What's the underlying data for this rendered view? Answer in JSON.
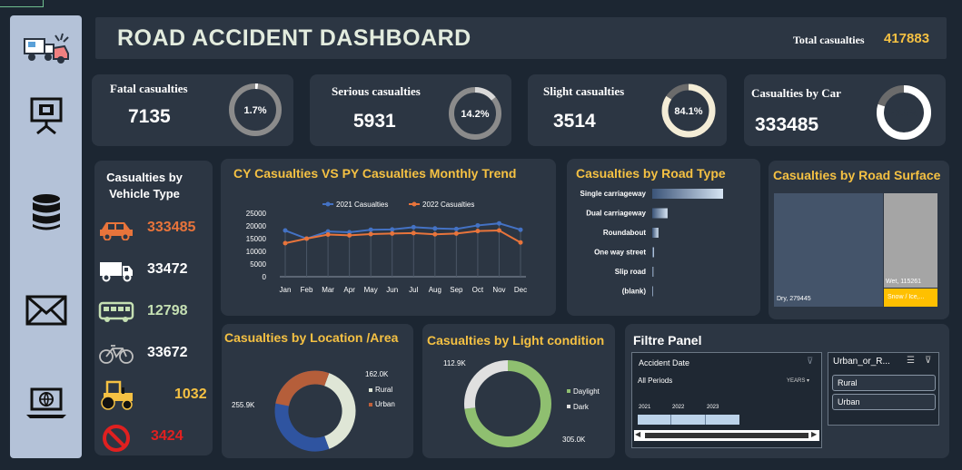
{
  "header": {
    "title": "ROAD ACCIDENT DASHBOARD",
    "total_label": "Total casualties",
    "total_value": "417883"
  },
  "sidebar": {
    "icons": [
      "accident-icon",
      "presentation-icon",
      "database-icon",
      "mail-icon",
      "laptop-globe-icon"
    ]
  },
  "kpis": [
    {
      "label": "Fatal casualties",
      "value": "7135",
      "pct_label": "1.7%",
      "pct": 1.7,
      "ring_color": "#8b8b8b"
    },
    {
      "label": "Serious casualties",
      "value": "5931",
      "pct_label": "14.2%",
      "pct": 14.2,
      "ring_color": "#8b8b8b"
    },
    {
      "label": "Slight casualties",
      "value": "3514",
      "pct_label": "84.1%",
      "pct": 84.1,
      "ring_color": "#f3ecd6"
    },
    {
      "label": "Casualties by Car",
      "value": "333485",
      "pct_label": "79.8%",
      "pct": 79.8,
      "ring_color": "#ffffff"
    }
  ],
  "vehicle_panel": {
    "title_line1": "Casualties by",
    "title_line2": "Vehicle Type",
    "items": [
      {
        "icon": "car-icon",
        "value": "333485",
        "color": "#e8743b"
      },
      {
        "icon": "truck-icon",
        "value": "33472",
        "color": "#ffffff"
      },
      {
        "icon": "bus-icon",
        "value": "12798",
        "color": "#c5e0b3"
      },
      {
        "icon": "bicycle-icon",
        "value": "33672",
        "color": "#ffffff"
      },
      {
        "icon": "tractor-icon",
        "value": "1032",
        "color": "#f5c143"
      },
      {
        "icon": "no-entry-icon",
        "value": "3424",
        "color": "#e02020"
      }
    ]
  },
  "trend": {
    "title": "CY Casualties VS PY Casualties Monthly Trend",
    "legend": [
      "2021 Casualties",
      "2022 Casualties"
    ]
  },
  "road_type": {
    "title": "Casualties  by Road Type"
  },
  "surface": {
    "title": "Casualties  by Road Surface",
    "labels": [
      "Dry, 279445",
      "Wet, 115261",
      "Snow / Ice,..."
    ]
  },
  "location": {
    "title": "Casualties  by Location /Area",
    "labels": [
      "162.0K",
      "255.9K"
    ],
    "legend": [
      "Rural",
      "Urban"
    ]
  },
  "light": {
    "title": "Casualties  by Light condition",
    "labels": [
      "112.9K",
      "305.0K"
    ],
    "legend": [
      "Daylight",
      "Dark"
    ]
  },
  "filter": {
    "title": "Filtre Panel",
    "timeline_title": "Accident  Date",
    "periods": "All Periods",
    "unit": "YEARS",
    "years": [
      "2021",
      "2022",
      "2023"
    ],
    "slicer_title": "Urban_or_R...",
    "slicer_items": [
      "Rural",
      "Urban"
    ]
  },
  "chart_data": [
    {
      "type": "line",
      "title": "CY Casualties VS PY Casualties Monthly Trend",
      "categories": [
        "Jan",
        "Feb",
        "Mar",
        "Apr",
        "May",
        "Jun",
        "Jul",
        "Aug",
        "Sep",
        "Oct",
        "Nov",
        "Dec"
      ],
      "series": [
        {
          "name": "2021 Casualties",
          "color": "#4472c4",
          "values": [
            18200,
            15000,
            17800,
            17500,
            18500,
            18600,
            19500,
            19000,
            18800,
            20200,
            21000,
            18500
          ]
        },
        {
          "name": "2022 Casualties",
          "color": "#e8743b",
          "values": [
            13200,
            15000,
            16600,
            16300,
            16800,
            17000,
            17200,
            16700,
            17000,
            18000,
            18200,
            13500
          ]
        }
      ],
      "ylim": [
        0,
        25000
      ],
      "yticks": [
        0,
        5000,
        10000,
        15000,
        20000,
        25000
      ]
    },
    {
      "type": "bar",
      "title": "Casualties  by Road Type",
      "categories": [
        "Single carriageway",
        "Dual carriageway",
        "Roundabout",
        "One way street",
        "Slip road",
        "(blank)"
      ],
      "values": [
        310000,
        67000,
        27000,
        8000,
        5000,
        0
      ]
    },
    {
      "type": "heatmap",
      "title": "Casualties  by Road Surface",
      "categories": [
        "Dry",
        "Wet",
        "Snow / Ice"
      ],
      "values": [
        279445,
        115261,
        23177
      ]
    },
    {
      "type": "pie",
      "title": "Casualties  by Location /Area",
      "categories": [
        "Rural",
        "Urban"
      ],
      "values": [
        162000,
        255900
      ]
    },
    {
      "type": "pie",
      "title": "Casualties  by Light condition",
      "categories": [
        "Daylight",
        "Dark"
      ],
      "values": [
        305000,
        112900
      ]
    }
  ]
}
